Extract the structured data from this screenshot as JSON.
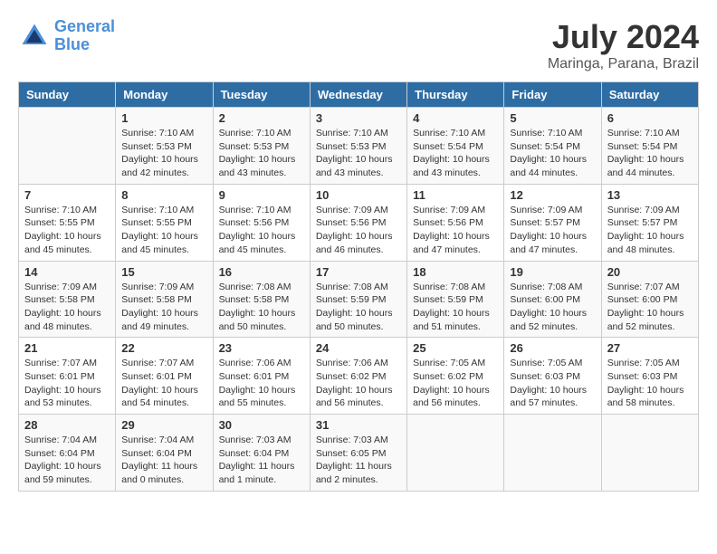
{
  "header": {
    "logo_line1": "General",
    "logo_line2": "Blue",
    "title": "July 2024",
    "location": "Maringa, Parana, Brazil"
  },
  "columns": [
    "Sunday",
    "Monday",
    "Tuesday",
    "Wednesday",
    "Thursday",
    "Friday",
    "Saturday"
  ],
  "weeks": [
    [
      {
        "num": "",
        "info": ""
      },
      {
        "num": "1",
        "info": "Sunrise: 7:10 AM\nSunset: 5:53 PM\nDaylight: 10 hours\nand 42 minutes."
      },
      {
        "num": "2",
        "info": "Sunrise: 7:10 AM\nSunset: 5:53 PM\nDaylight: 10 hours\nand 43 minutes."
      },
      {
        "num": "3",
        "info": "Sunrise: 7:10 AM\nSunset: 5:53 PM\nDaylight: 10 hours\nand 43 minutes."
      },
      {
        "num": "4",
        "info": "Sunrise: 7:10 AM\nSunset: 5:54 PM\nDaylight: 10 hours\nand 43 minutes."
      },
      {
        "num": "5",
        "info": "Sunrise: 7:10 AM\nSunset: 5:54 PM\nDaylight: 10 hours\nand 44 minutes."
      },
      {
        "num": "6",
        "info": "Sunrise: 7:10 AM\nSunset: 5:54 PM\nDaylight: 10 hours\nand 44 minutes."
      }
    ],
    [
      {
        "num": "7",
        "info": "Sunrise: 7:10 AM\nSunset: 5:55 PM\nDaylight: 10 hours\nand 45 minutes."
      },
      {
        "num": "8",
        "info": "Sunrise: 7:10 AM\nSunset: 5:55 PM\nDaylight: 10 hours\nand 45 minutes."
      },
      {
        "num": "9",
        "info": "Sunrise: 7:10 AM\nSunset: 5:56 PM\nDaylight: 10 hours\nand 45 minutes."
      },
      {
        "num": "10",
        "info": "Sunrise: 7:09 AM\nSunset: 5:56 PM\nDaylight: 10 hours\nand 46 minutes."
      },
      {
        "num": "11",
        "info": "Sunrise: 7:09 AM\nSunset: 5:56 PM\nDaylight: 10 hours\nand 47 minutes."
      },
      {
        "num": "12",
        "info": "Sunrise: 7:09 AM\nSunset: 5:57 PM\nDaylight: 10 hours\nand 47 minutes."
      },
      {
        "num": "13",
        "info": "Sunrise: 7:09 AM\nSunset: 5:57 PM\nDaylight: 10 hours\nand 48 minutes."
      }
    ],
    [
      {
        "num": "14",
        "info": "Sunrise: 7:09 AM\nSunset: 5:58 PM\nDaylight: 10 hours\nand 48 minutes."
      },
      {
        "num": "15",
        "info": "Sunrise: 7:09 AM\nSunset: 5:58 PM\nDaylight: 10 hours\nand 49 minutes."
      },
      {
        "num": "16",
        "info": "Sunrise: 7:08 AM\nSunset: 5:58 PM\nDaylight: 10 hours\nand 50 minutes."
      },
      {
        "num": "17",
        "info": "Sunrise: 7:08 AM\nSunset: 5:59 PM\nDaylight: 10 hours\nand 50 minutes."
      },
      {
        "num": "18",
        "info": "Sunrise: 7:08 AM\nSunset: 5:59 PM\nDaylight: 10 hours\nand 51 minutes."
      },
      {
        "num": "19",
        "info": "Sunrise: 7:08 AM\nSunset: 6:00 PM\nDaylight: 10 hours\nand 52 minutes."
      },
      {
        "num": "20",
        "info": "Sunrise: 7:07 AM\nSunset: 6:00 PM\nDaylight: 10 hours\nand 52 minutes."
      }
    ],
    [
      {
        "num": "21",
        "info": "Sunrise: 7:07 AM\nSunset: 6:01 PM\nDaylight: 10 hours\nand 53 minutes."
      },
      {
        "num": "22",
        "info": "Sunrise: 7:07 AM\nSunset: 6:01 PM\nDaylight: 10 hours\nand 54 minutes."
      },
      {
        "num": "23",
        "info": "Sunrise: 7:06 AM\nSunset: 6:01 PM\nDaylight: 10 hours\nand 55 minutes."
      },
      {
        "num": "24",
        "info": "Sunrise: 7:06 AM\nSunset: 6:02 PM\nDaylight: 10 hours\nand 56 minutes."
      },
      {
        "num": "25",
        "info": "Sunrise: 7:05 AM\nSunset: 6:02 PM\nDaylight: 10 hours\nand 56 minutes."
      },
      {
        "num": "26",
        "info": "Sunrise: 7:05 AM\nSunset: 6:03 PM\nDaylight: 10 hours\nand 57 minutes."
      },
      {
        "num": "27",
        "info": "Sunrise: 7:05 AM\nSunset: 6:03 PM\nDaylight: 10 hours\nand 58 minutes."
      }
    ],
    [
      {
        "num": "28",
        "info": "Sunrise: 7:04 AM\nSunset: 6:04 PM\nDaylight: 10 hours\nand 59 minutes."
      },
      {
        "num": "29",
        "info": "Sunrise: 7:04 AM\nSunset: 6:04 PM\nDaylight: 11 hours\nand 0 minutes."
      },
      {
        "num": "30",
        "info": "Sunrise: 7:03 AM\nSunset: 6:04 PM\nDaylight: 11 hours\nand 1 minute."
      },
      {
        "num": "31",
        "info": "Sunrise: 7:03 AM\nSunset: 6:05 PM\nDaylight: 11 hours\nand 2 minutes."
      },
      {
        "num": "",
        "info": ""
      },
      {
        "num": "",
        "info": ""
      },
      {
        "num": "",
        "info": ""
      }
    ]
  ]
}
